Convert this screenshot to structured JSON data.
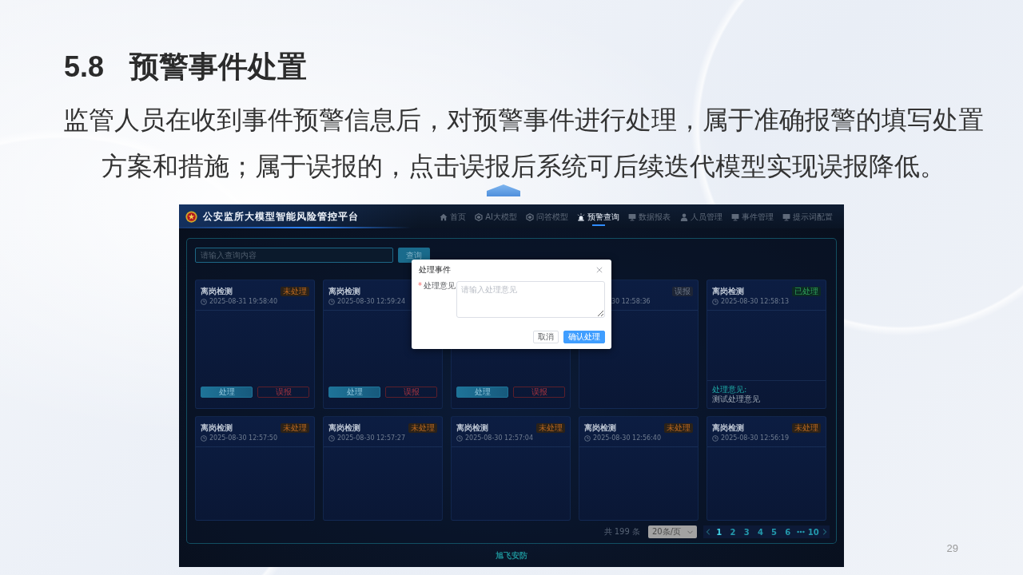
{
  "slide": {
    "section_number": "5.8",
    "title": "预警事件处置",
    "paragraph": "监管人员在收到事件预警信息后，对预警事件进行处理，属于准确报警的填写处置方案和措施；属于误报的，点击误报后系统可后续迭代模型实现误报降低。",
    "page_number": "29"
  },
  "app": {
    "header": {
      "title": "公安监所大模型智能风险管控平台",
      "nav": [
        {
          "label": "首页",
          "selected": false
        },
        {
          "label": "AI大模型",
          "selected": false
        },
        {
          "label": "问答模型",
          "selected": false
        },
        {
          "label": "预警查询",
          "selected": true
        },
        {
          "label": "数据报表",
          "selected": false
        },
        {
          "label": "人员管理",
          "selected": false
        },
        {
          "label": "事件管理",
          "selected": false
        },
        {
          "label": "提示词配置",
          "selected": false
        }
      ]
    },
    "search": {
      "placeholder": "请输入查询内容",
      "button": "查询"
    },
    "cards": [
      {
        "kind": "full",
        "title": "离岗检测",
        "time": "2025-08-31 19:58:40",
        "tag": {
          "label": "未处理",
          "kind": "pending"
        },
        "actions": [
          {
            "label": "处理",
            "kind": "primary"
          },
          {
            "label": "误报",
            "kind": "danger"
          }
        ]
      },
      {
        "kind": "full",
        "title": "离岗检测",
        "time": "2025-08-30 12:59:24",
        "actions": [
          {
            "label": "处理",
            "kind": "primary"
          },
          {
            "label": "误报",
            "kind": "danger"
          }
        ]
      },
      {
        "kind": "covered",
        "actions": [
          {
            "label": "处理",
            "kind": "primary"
          },
          {
            "label": "误报",
            "kind": "danger"
          }
        ]
      },
      {
        "kind": "covered",
        "time": "30 12:58:36",
        "tag": {
          "label": "误报",
          "kind": "false_alarm"
        }
      },
      {
        "kind": "full",
        "title": "离岗检测",
        "time": "2025-08-30 12:58:13",
        "tag": {
          "label": "已处理",
          "kind": "done"
        },
        "opinion": {
          "label": "处理意见:",
          "text": "测试处理意见"
        }
      },
      {
        "kind": "full",
        "title": "离岗检测",
        "time": "2025-08-30 12:57:50",
        "tag": {
          "label": "未处理",
          "kind": "pending"
        }
      },
      {
        "kind": "full",
        "title": "离岗检测",
        "time": "2025-08-30 12:57:27",
        "tag": {
          "label": "未处理",
          "kind": "pending"
        }
      },
      {
        "kind": "full",
        "title": "离岗检测",
        "time": "2025-08-30 12:57:04",
        "tag": {
          "label": "未处理",
          "kind": "pending"
        }
      },
      {
        "kind": "full",
        "title": "离岗检测",
        "time": "2025-08-30 12:56:40",
        "tag": {
          "label": "未处理",
          "kind": "pending"
        }
      },
      {
        "kind": "full",
        "title": "离岗检测",
        "time": "2025-08-30 12:56:19",
        "tag": {
          "label": "未处理",
          "kind": "pending"
        }
      }
    ],
    "pagination": {
      "total": "共 199 条",
      "page_size": "20条/页",
      "pages": [
        {
          "label": "1",
          "selected": true
        },
        {
          "label": "2",
          "selected": false
        },
        {
          "label": "3",
          "selected": false
        },
        {
          "label": "4",
          "selected": false
        },
        {
          "label": "5",
          "selected": false
        },
        {
          "label": "6",
          "selected": false
        }
      ],
      "last_page": {
        "label": "10",
        "selected": false
      }
    },
    "footer": "旭飞安防"
  },
  "dialog": {
    "title": "处理事件",
    "required_mark": "*",
    "field_label": "处理意见",
    "placeholder": "请输入处理意见",
    "buttons": [
      {
        "label": "取消",
        "kind": "default"
      },
      {
        "label": "确认处理",
        "kind": "primary"
      }
    ]
  }
}
